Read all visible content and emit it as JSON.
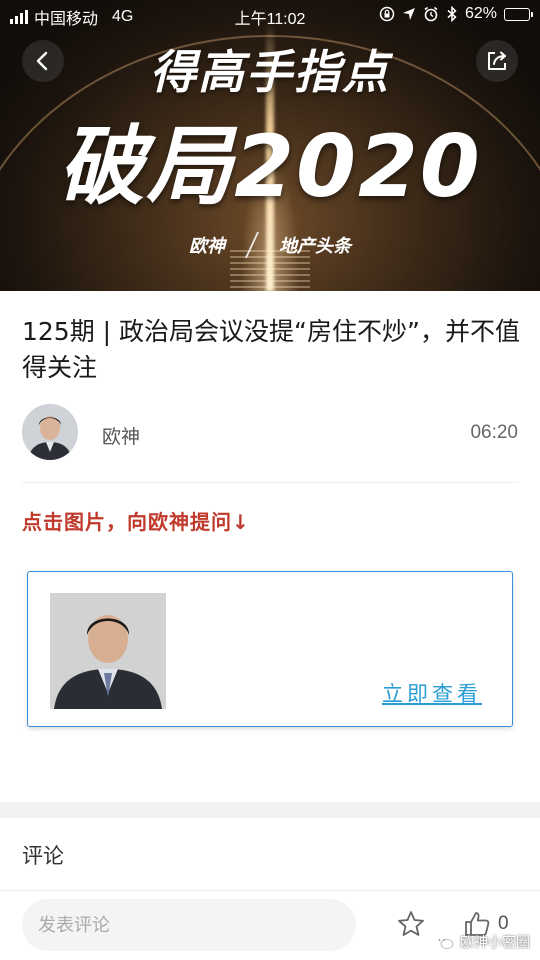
{
  "status_bar": {
    "carrier": "中国移动",
    "network": "4G",
    "time": "上午11:02",
    "battery_percent": "62%",
    "battery_level": 0.62
  },
  "banner": {
    "line1": "得高手指点",
    "line2": "破局2020",
    "tag_left": "欧神",
    "tag_right": "地产头条"
  },
  "article": {
    "title": "125期 | 政治局会议没提“房住不炒”，并不值得关注",
    "author": "欧神",
    "duration": "06:20"
  },
  "cta": {
    "text": "点击图片，向欧神提问↓",
    "card_link": "立即查看"
  },
  "comments": {
    "heading": "评论",
    "input_placeholder": "发表评论",
    "like_count": "0"
  },
  "watermark": {
    "text": "欧神小密圈"
  },
  "colors": {
    "cta_red": "#c0392b",
    "link_blue": "#2a9dd4",
    "card_border": "#3a8fd6"
  },
  "icons": {
    "back": "chevron-left-icon",
    "share": "share-icon",
    "star": "star-icon",
    "like": "thumbs-up-icon"
  }
}
